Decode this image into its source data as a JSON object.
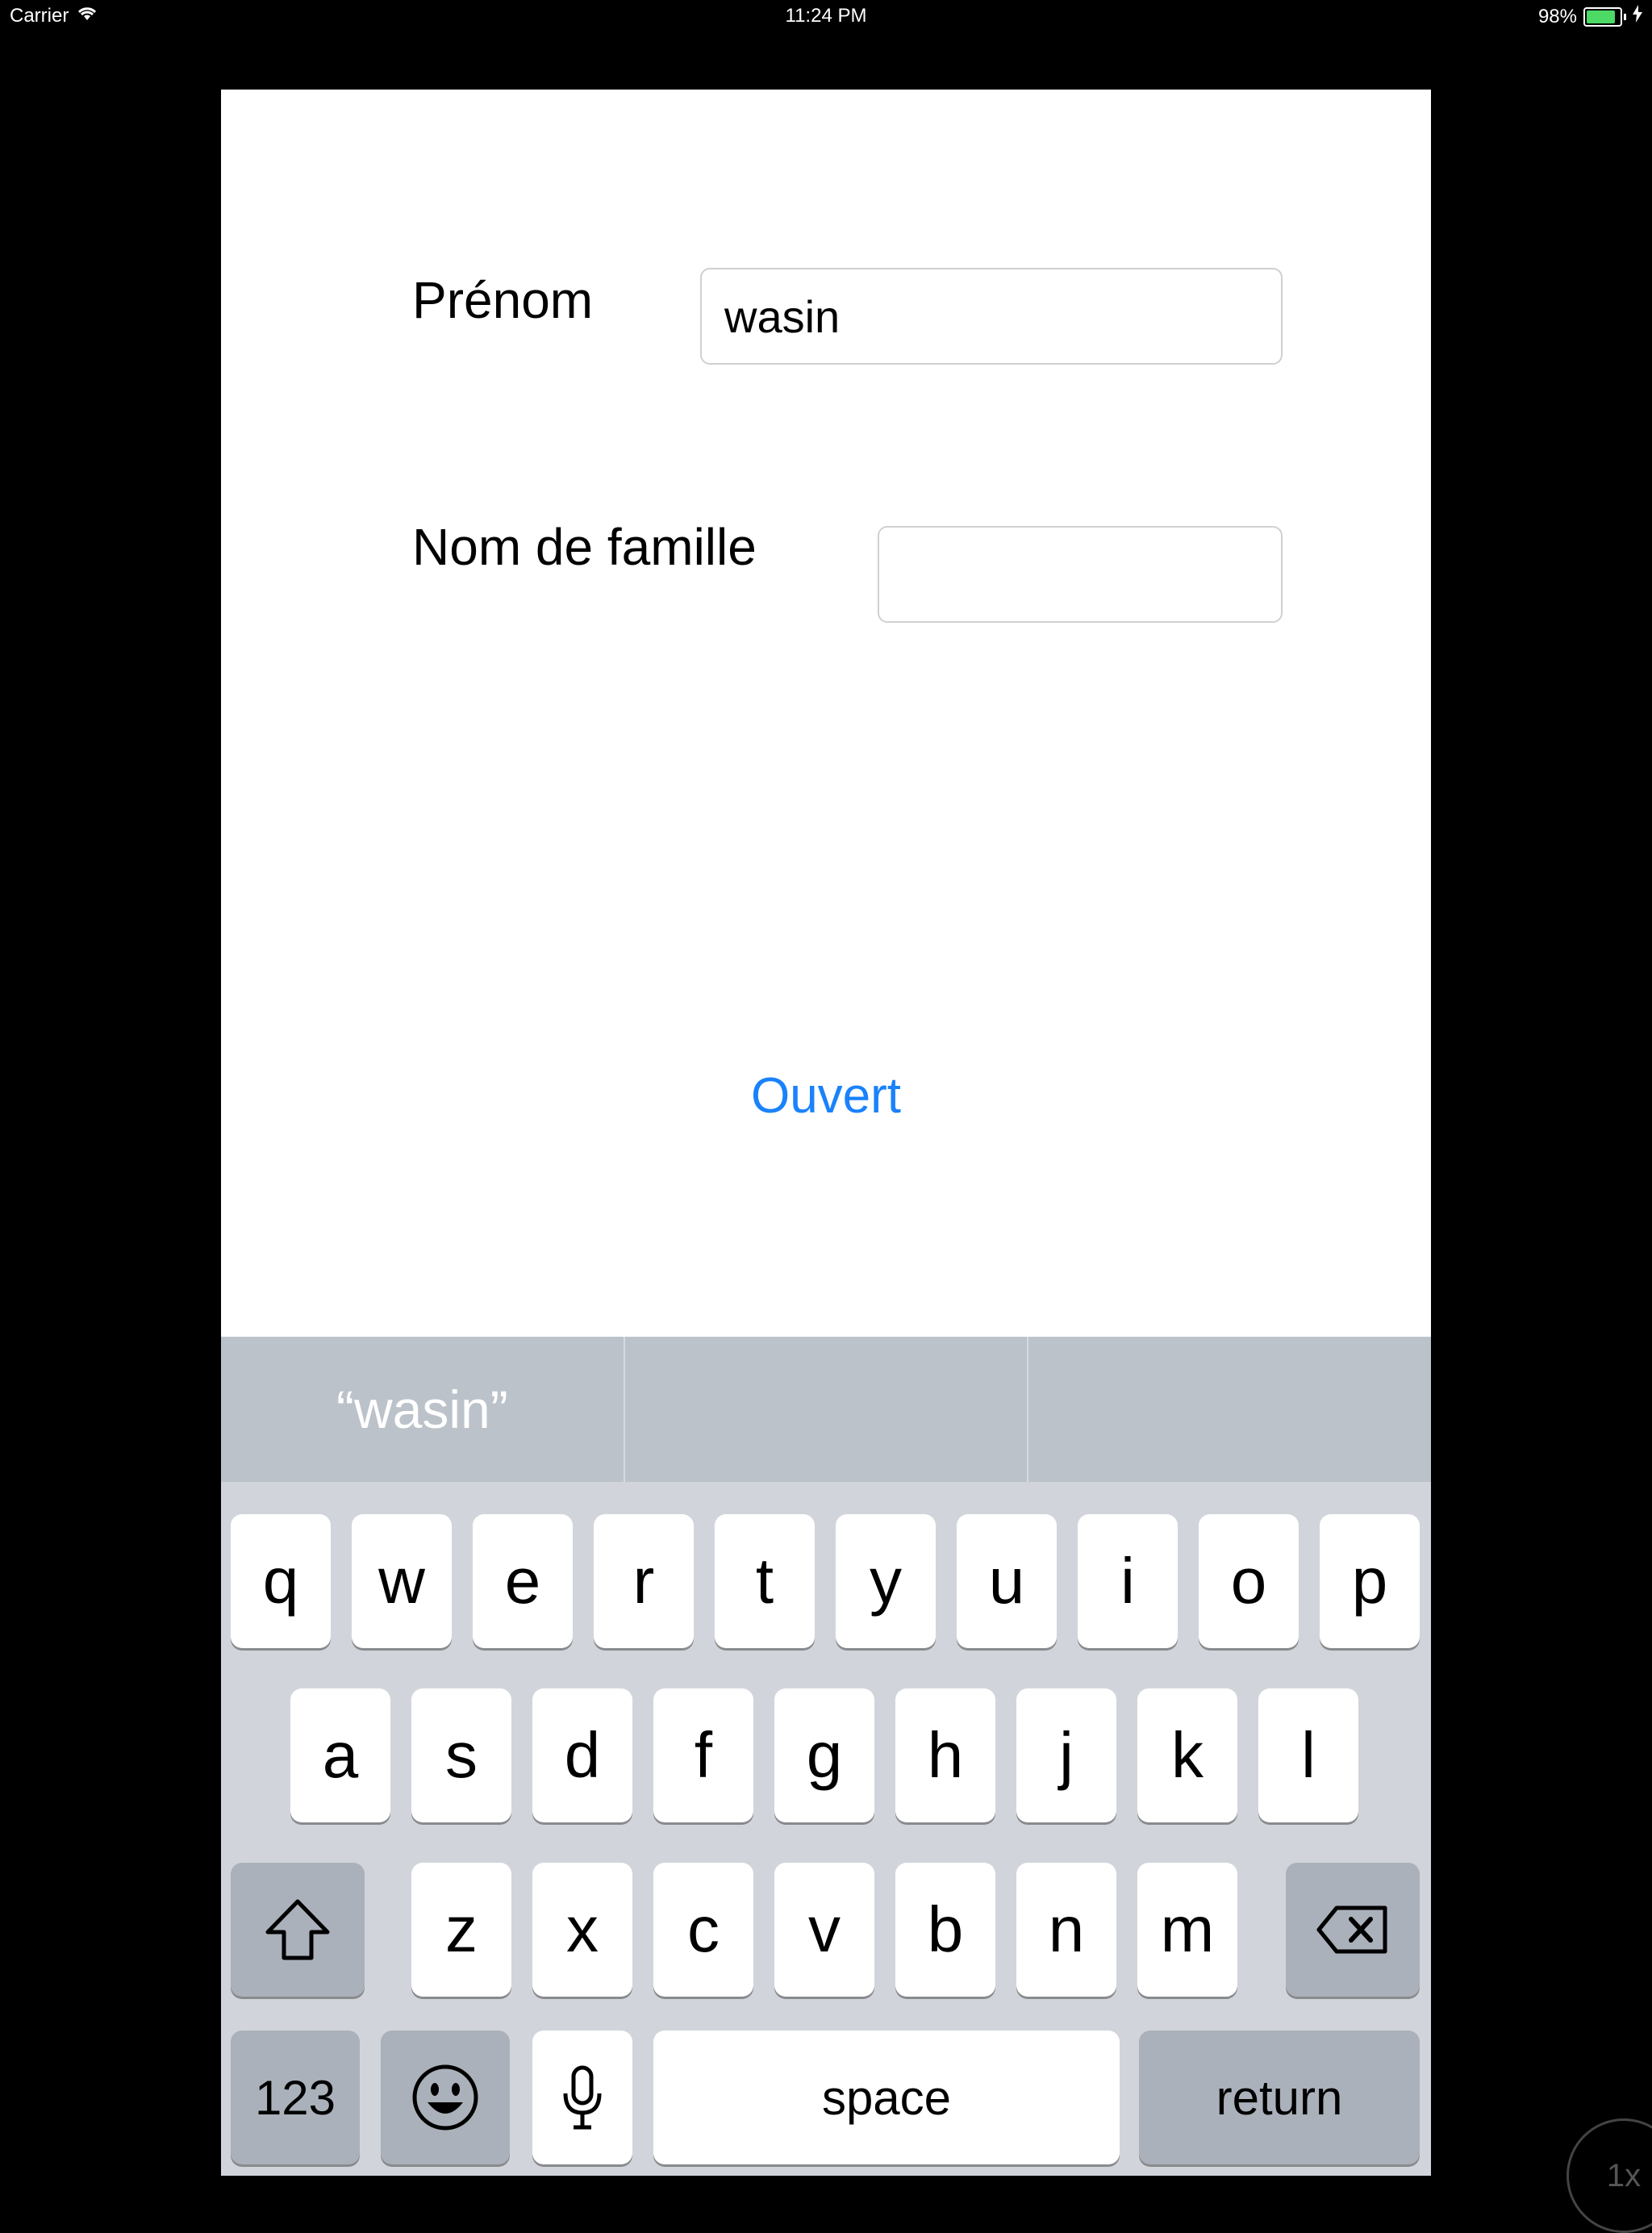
{
  "status_bar": {
    "carrier": "Carrier",
    "time": "11:24 PM",
    "battery_percent": "98%",
    "battery_level": 0.98
  },
  "form": {
    "first_name_label": "Prénom",
    "first_name_value": "wasin",
    "last_name_label": "Nom de famille",
    "last_name_value": "",
    "open_button": "Ouvert"
  },
  "keyboard": {
    "suggestions": [
      "“wasin”",
      "",
      ""
    ],
    "row1": [
      "q",
      "w",
      "e",
      "r",
      "t",
      "y",
      "u",
      "i",
      "o",
      "p"
    ],
    "row2": [
      "a",
      "s",
      "d",
      "f",
      "g",
      "h",
      "j",
      "k",
      "l"
    ],
    "row3": [
      "z",
      "x",
      "c",
      "v",
      "b",
      "n",
      "m"
    ],
    "numbers_label": "123",
    "space_label": "space",
    "return_label": "return",
    "icons": [
      "shift-icon",
      "backspace-icon",
      "emoji-icon",
      "microphone-icon"
    ]
  },
  "zoom_indicator": "1x",
  "colors": {
    "accent": "#1a82fb",
    "battery_green": "#4cd964",
    "keyboard_bg": "#d1d5db",
    "suggestion_bg": "#bcc2ca"
  }
}
